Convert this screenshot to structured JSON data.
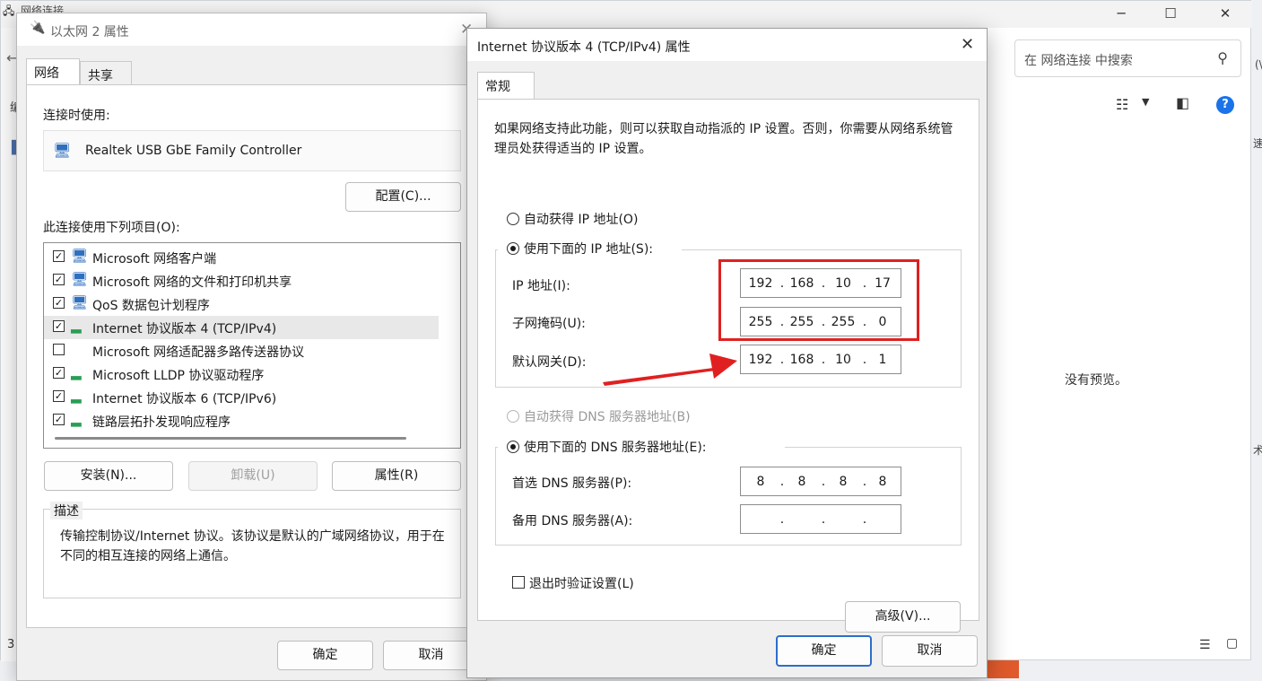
{
  "explorer": {
    "title": "网络连接",
    "search_placeholder": "在 网络连接 中搜索",
    "no_preview": "没有预览。",
    "item_count": "3",
    "clipped_left_char": "编",
    "clipped_right_1": "(\\",
    "clipped_right_2": "速",
    "clipped_right_3": "术"
  },
  "eth_dialog": {
    "title": "以太网 2 属性",
    "tabs": [
      "网络",
      "共享"
    ],
    "connect_using_label": "连接时使用:",
    "adapter_name": "Realtek USB GbE Family Controller",
    "configure_button": "配置(C)...",
    "items_label": "此连接使用下列项目(O):",
    "items": [
      {
        "label": "Microsoft 网络客户端",
        "checked": true,
        "icon": "network-client-icon"
      },
      {
        "label": "Microsoft 网络的文件和打印机共享",
        "checked": true,
        "icon": "file-share-icon"
      },
      {
        "label": "QoS 数据包计划程序",
        "checked": true,
        "icon": "qos-icon"
      },
      {
        "label": "Internet 协议版本 4 (TCP/IPv4)",
        "checked": true,
        "icon": "protocol-icon"
      },
      {
        "label": "Microsoft 网络适配器多路传送器协议",
        "checked": false,
        "icon": "protocol-icon"
      },
      {
        "label": "Microsoft LLDP 协议驱动程序",
        "checked": true,
        "icon": "protocol-icon"
      },
      {
        "label": "Internet 协议版本 6 (TCP/IPv6)",
        "checked": true,
        "icon": "protocol-icon"
      },
      {
        "label": "链路层拓扑发现响应程序",
        "checked": true,
        "icon": "protocol-icon"
      }
    ],
    "install_button": "安装(N)...",
    "uninstall_button": "卸载(U)",
    "properties_button": "属性(R)",
    "description_title": "描述",
    "description_text": "传输控制协议/Internet 协议。该协议是默认的广域网络协议，用于在不同的相互连接的网络上通信。",
    "ok_button": "确定",
    "cancel_button": "取消"
  },
  "ipv4_dialog": {
    "title": "Internet 协议版本 4 (TCP/IPv4) 属性",
    "tab": "常规",
    "intro": "如果网络支持此功能，则可以获取自动指派的 IP 设置。否则，你需要从网络系统管理员处获得适当的 IP 设置。",
    "auto_ip_label": "自动获得 IP 地址(O)",
    "manual_ip_label": "使用下面的 IP 地址(S):",
    "ip_address_label": "IP 地址(I):",
    "ip_address": [
      "192",
      "168",
      "10",
      "17"
    ],
    "subnet_label": "子网掩码(U):",
    "subnet": [
      "255",
      "255",
      "255",
      "0"
    ],
    "gateway_label": "默认网关(D):",
    "gateway": [
      "192",
      "168",
      "10",
      "1"
    ],
    "auto_dns_label": "自动获得 DNS 服务器地址(B)",
    "manual_dns_label": "使用下面的 DNS 服务器地址(E):",
    "preferred_dns_label": "首选 DNS 服务器(P):",
    "preferred_dns": [
      "8",
      "8",
      "8",
      "8"
    ],
    "alternate_dns_label": "备用 DNS 服务器(A):",
    "alternate_dns": [
      "",
      "",
      "",
      ""
    ],
    "validate_label": "退出时验证设置(L)",
    "advanced_button": "高级(V)...",
    "ok_button": "确定",
    "cancel_button": "取消",
    "selected_ip_mode": "manual",
    "selected_dns_mode": "manual",
    "validate_checked": false
  },
  "annotation": {
    "highlight_color": "#e02020"
  }
}
